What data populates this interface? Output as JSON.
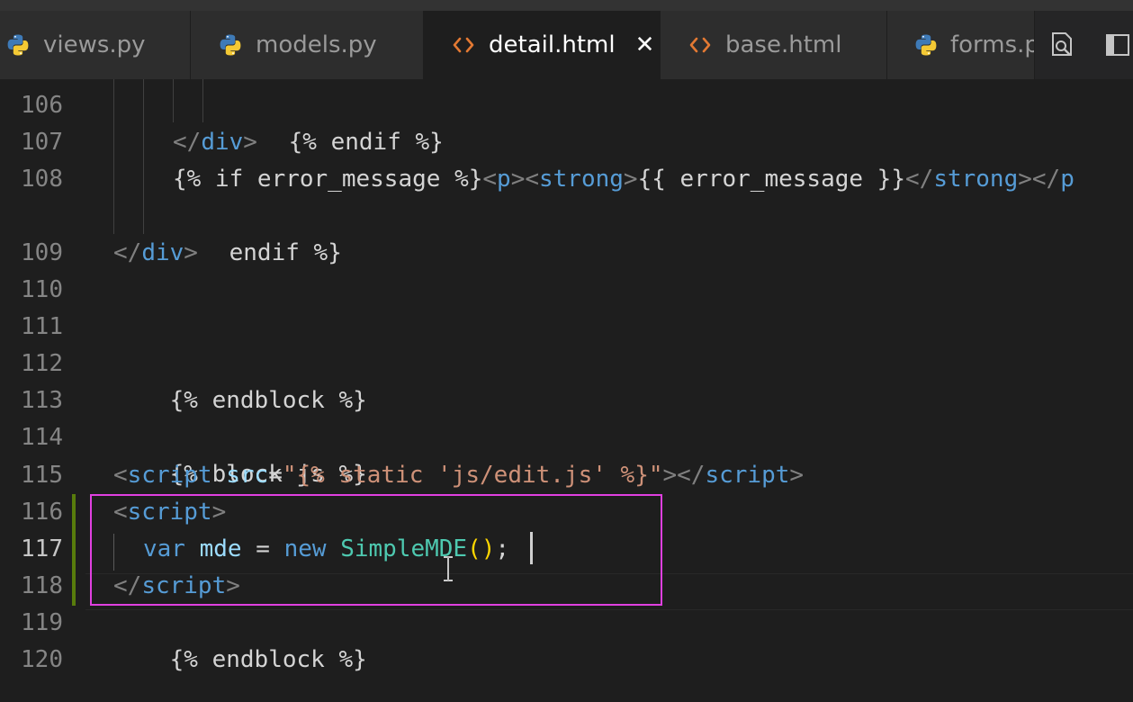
{
  "tabs": [
    {
      "label": "views.py",
      "icon": "python-icon",
      "active": false
    },
    {
      "label": "models.py",
      "icon": "python-icon",
      "active": false
    },
    {
      "label": "detail.html",
      "icon": "html-icon",
      "active": true
    },
    {
      "label": "base.html",
      "icon": "html-icon",
      "active": false
    },
    {
      "label": "forms.p",
      "icon": "python-icon",
      "active": false
    }
  ],
  "tab_close_glyph": "✕",
  "editor_actions": [
    "open-preview-icon",
    "split-editor-icon"
  ],
  "editor": {
    "current_line": "117",
    "highlighted_lines": [
      "116",
      "117",
      "118"
    ],
    "highlight_color": "#e040e0",
    "gutter_numbers": [
      "106",
      "107",
      "108",
      "109",
      "110",
      "111",
      "112",
      "113",
      "114",
      "115",
      "116",
      "117",
      "118",
      "119",
      "120"
    ],
    "lines": {
      "l106": {
        "tpl": "{% endif %}"
      },
      "l107": {
        "open": "</",
        "tag": "div",
        "close": ">"
      },
      "l108a": {
        "tpl1": "{% if error_message %}",
        "p_open_a": "<",
        "p": "p",
        "p_open_b": ">",
        "s_open_a": "<",
        "strong": "strong",
        "s_open_b": ">",
        "tpl2": "{{ error_message }}",
        "s_close_a": "</",
        "strong2": "strong",
        "s_close_b": ">",
        "p_close_a": "</",
        "p2": "p"
      },
      "l108b": {
        "tpl": "endif %}"
      },
      "l109": {
        "open": "</",
        "tag": "div",
        "close": ">"
      },
      "l112": {
        "tpl": "{% endblock %}"
      },
      "l114": {
        "tpl": "{% block js %}"
      },
      "l115": {
        "open": "<",
        "tag": "script",
        "attr": "src",
        "eq": "=",
        "str": "\"{% static 'js/edit.js' %}\"",
        "mid": "></",
        "tag2": "script",
        "close": ">"
      },
      "l116": {
        "open": "<",
        "tag": "script",
        "close": ">"
      },
      "l117": {
        "kw": "var",
        "var": "mde",
        "op": " = ",
        "kw2": "new",
        "cls": "SimpleMDE",
        "paren": "()",
        "semi": ";"
      },
      "l118": {
        "open": "</",
        "tag": "script",
        "close": ">"
      },
      "l119": {
        "tpl": "{% endblock %}"
      }
    }
  }
}
